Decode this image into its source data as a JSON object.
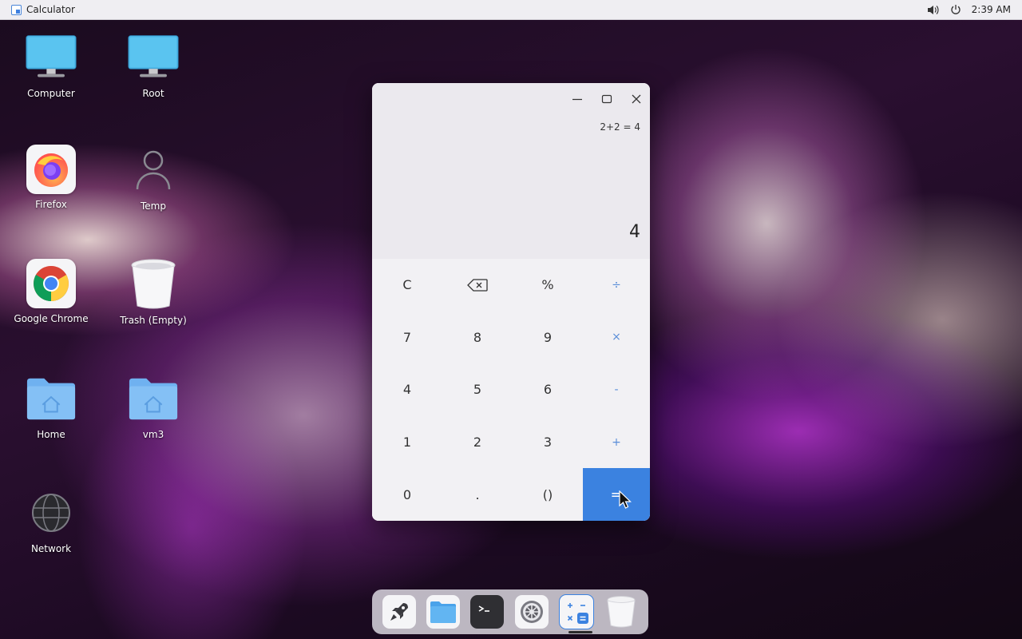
{
  "top_panel": {
    "title": "Calculator",
    "time": "2:39 AM",
    "icons": [
      "volume-icon",
      "power-icon"
    ]
  },
  "desktop": {
    "icons": [
      {
        "label": "Computer",
        "icon": "monitor-icon"
      },
      {
        "label": "Root",
        "icon": "monitor-icon"
      },
      {
        "label": "Firefox",
        "icon": "firefox-icon"
      },
      {
        "label": "Temp",
        "icon": "user-icon"
      },
      {
        "label": "Google Chrome",
        "icon": "chrome-icon"
      },
      {
        "label": "Trash (Empty)",
        "icon": "trash-icon"
      },
      {
        "label": "Home",
        "icon": "home-folder-icon"
      },
      {
        "label": "vm3",
        "icon": "home-folder-icon"
      },
      {
        "label": "Network",
        "icon": "network-globe-icon"
      }
    ]
  },
  "calculator": {
    "expression": "2+2 = 4",
    "result": "4",
    "window_controls": [
      "minimize-icon",
      "maximize-icon",
      "close-icon"
    ],
    "keys": [
      [
        "C",
        "⌫",
        "%",
        "÷"
      ],
      [
        "7",
        "8",
        "9",
        "×"
      ],
      [
        "4",
        "5",
        "6",
        "-"
      ],
      [
        "1",
        "2",
        "3",
        "+"
      ],
      [
        "0",
        ".",
        "()",
        "="
      ]
    ],
    "accent_color": "#3b82e0"
  },
  "dock": {
    "items": [
      {
        "name": "launcher",
        "icon": "rocket-icon"
      },
      {
        "name": "files",
        "icon": "folder-icon"
      },
      {
        "name": "terminal",
        "icon": "terminal-icon"
      },
      {
        "name": "settings",
        "icon": "gear-icon"
      },
      {
        "name": "calculator",
        "icon": "calculator-icon"
      },
      {
        "name": "trash",
        "icon": "trash-icon"
      }
    ]
  }
}
